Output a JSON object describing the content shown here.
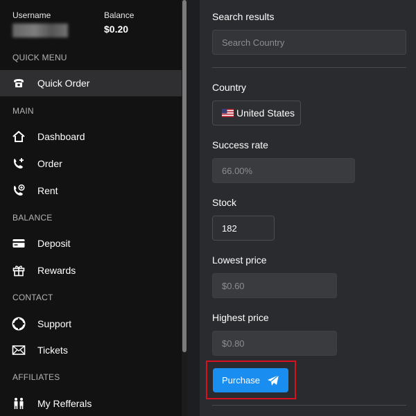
{
  "user": {
    "username_label": "Username",
    "balance_label": "Balance",
    "balance_value": "$0.20"
  },
  "sidebar": {
    "sections": [
      {
        "label": "QUICK MENU"
      },
      {
        "label": "MAIN"
      },
      {
        "label": "BALANCE"
      },
      {
        "label": "CONTACT"
      },
      {
        "label": "AFFILIATES"
      }
    ],
    "items": [
      {
        "label": "Quick Order",
        "icon": "phone-icon",
        "active": true
      },
      {
        "label": "Dashboard",
        "icon": "home-icon"
      },
      {
        "label": "Order",
        "icon": "phone-plus-icon"
      },
      {
        "label": "Rent",
        "icon": "phone-rent-icon"
      },
      {
        "label": "Deposit",
        "icon": "credit-card-icon"
      },
      {
        "label": "Rewards",
        "icon": "gift-icon"
      },
      {
        "label": "Support",
        "icon": "lifebuoy-icon"
      },
      {
        "label": "Tickets",
        "icon": "envelope-icon"
      },
      {
        "label": "My Refferals",
        "icon": "users-icon"
      }
    ]
  },
  "main": {
    "search": {
      "label": "Search results",
      "placeholder": "Search Country"
    },
    "country": {
      "label": "Country",
      "value": "United States",
      "flag_icon": "us-flag-icon"
    },
    "success_rate": {
      "label": "Success rate",
      "value": "66.00%"
    },
    "stock": {
      "label": "Stock",
      "value": "182"
    },
    "lowest_price": {
      "label": "Lowest price",
      "value": "$0.60"
    },
    "highest_price": {
      "label": "Highest price",
      "value": "$0.80"
    },
    "purchase": {
      "label": "Purchase",
      "icon": "paper-plane-icon"
    }
  },
  "colors": {
    "sidebar_bg": "#121212",
    "main_bg": "#2a2b2f",
    "accent": "#1a8df0",
    "highlight": "#d8111f"
  }
}
